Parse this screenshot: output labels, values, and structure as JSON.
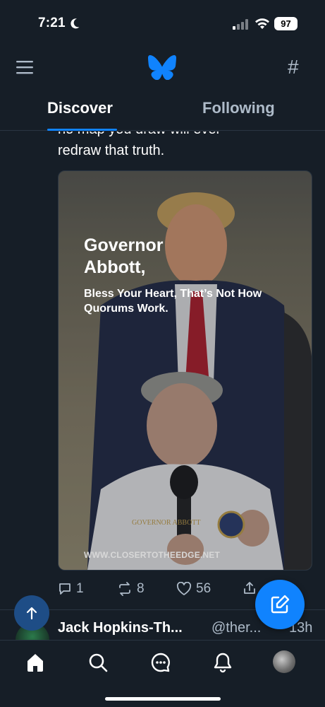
{
  "status_bar": {
    "time": "7:21",
    "battery": "97"
  },
  "header": {
    "menu_icon": "hamburger-icon",
    "logo_icon": "butterfly-logo",
    "feeds_icon": "hash-icon"
  },
  "tabs": [
    {
      "label": "Discover",
      "active": true
    },
    {
      "label": "Following",
      "active": false
    }
  ],
  "post": {
    "text_prev_line": "no map you draw will ever",
    "text_line": "redraw that truth.",
    "image": {
      "title": "Governor Abbott,",
      "subtitle": "Bless Your Heart, That’s Not How Quorums Work.",
      "url": "WWW.CLOSERTOTHEEDGE.NET"
    },
    "actions": {
      "replies": "1",
      "reposts": "8",
      "likes": "56"
    }
  },
  "next_post": {
    "name": "Jack Hopkins-Th...",
    "handle": "@ther...",
    "time": "13h"
  },
  "bottom_nav": [
    "home-icon",
    "search-icon",
    "chat-icon",
    "bell-icon",
    "profile-avatar"
  ],
  "colors": {
    "background": "#161e27",
    "accent": "#1083fe",
    "muted": "#aebbc9"
  }
}
